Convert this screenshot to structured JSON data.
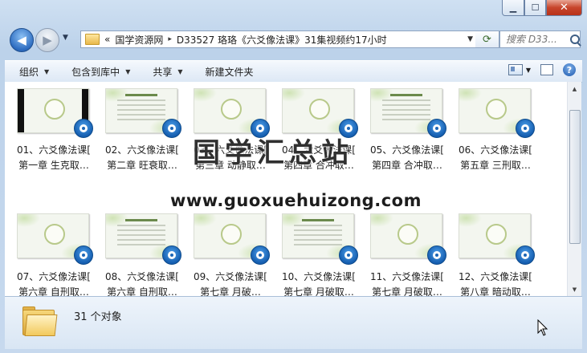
{
  "window": {
    "caption_buttons": {
      "minimize": "▁",
      "maximize": "☐",
      "close": "✕"
    }
  },
  "nav": {
    "back_glyph": "◀",
    "forward_glyph": "▶",
    "history_glyph": "▼",
    "address": {
      "prefix": "«",
      "parts": [
        "国学资源网",
        "D33527 珞珞《六爻像法课》31集视频约17小时"
      ],
      "separator": "▸"
    },
    "refresh_glyph": "⟳",
    "search": {
      "placeholder": "搜索 D33..."
    }
  },
  "toolbar": {
    "items": [
      {
        "label": "组织",
        "dropdown": true
      },
      {
        "label": "包含到库中",
        "dropdown": true
      },
      {
        "label": "共享",
        "dropdown": true
      },
      {
        "label": "新建文件夹",
        "dropdown": false
      }
    ],
    "help_glyph": "?"
  },
  "files": [
    {
      "line1": "01、六爻像法课[",
      "line2": "第一章 生克取…",
      "thumb": "black"
    },
    {
      "line1": "02、六爻像法课[",
      "line2": "第二章  旺衰取…",
      "thumb": "text"
    },
    {
      "line1": "03、六爻像法课[",
      "line2": "第三章 动静取…",
      "thumb": "circle"
    },
    {
      "line1": "04、六爻像法课[",
      "line2": "第四章 合冲取…",
      "thumb": "circle"
    },
    {
      "line1": "05、六爻像法课[",
      "line2": "第四章 合冲取…",
      "thumb": "text"
    },
    {
      "line1": "06、六爻像法课[",
      "line2": "第五章 三刑取…",
      "thumb": "circle"
    },
    {
      "line1": "07、六爻像法课[",
      "line2": "第六章  自刑取…",
      "thumb": "circle"
    },
    {
      "line1": "08、六爻像法课[",
      "line2": "第六章    自刑取…",
      "thumb": "text"
    },
    {
      "line1": "09、六爻像法课[",
      "line2": "第七章     月破…",
      "thumb": "circle"
    },
    {
      "line1": "10、六爻像法课[",
      "line2": "第七章  月破取…",
      "thumb": "text"
    },
    {
      "line1": "11、六爻像法课[",
      "line2": "第七章  月破取…",
      "thumb": "circle"
    },
    {
      "line1": "12、六爻像法课[",
      "line2": "第八章   暗动取…",
      "thumb": "circle"
    }
  ],
  "watermark": {
    "title": "国学汇总站",
    "url": "www.guoxuehuizong.com"
  },
  "status": {
    "count_text": "31 个对象"
  },
  "colors": {
    "accent": "#1c66b6",
    "window_bg": "#c7d9ee"
  }
}
